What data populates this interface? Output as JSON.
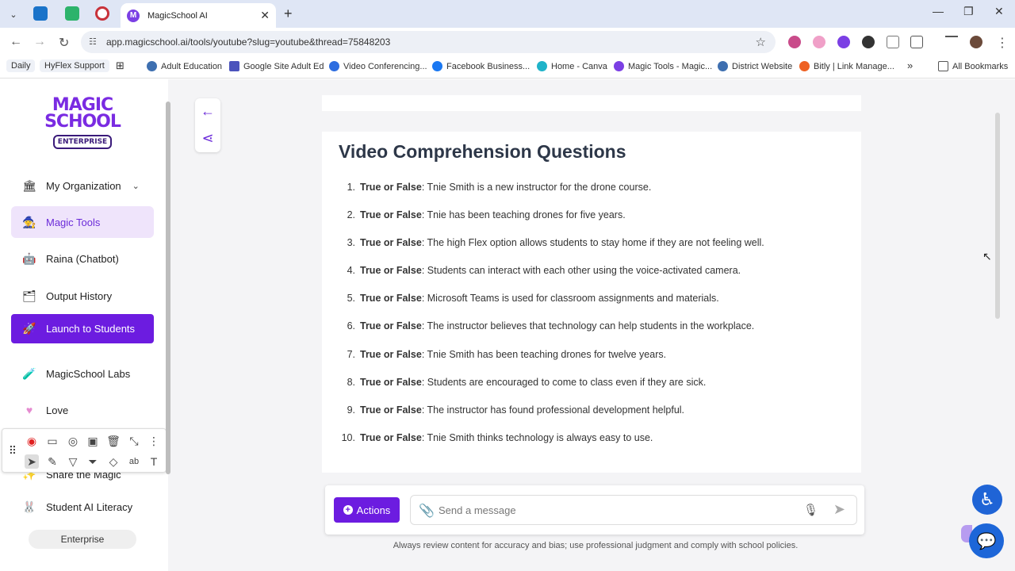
{
  "browser": {
    "tab_title": "MagicSchool AI",
    "tab_favicon": "M",
    "url": "app.magicschool.ai/tools/youtube?slug=youtube&thread=75848203",
    "bookmarks": [
      "Daily",
      "HyFlex Support",
      "Adult Education",
      "Google Site Adult Ed",
      "Video Conferencing...",
      "Facebook Business...",
      "Home - Canva",
      "Magic Tools - Magic...",
      "District Website",
      "Bitly | Link Manage...",
      "All Bookmarks"
    ]
  },
  "sidebar": {
    "logo_line1": "MAGIC",
    "logo_line2": "SCHOOL",
    "logo_badge": "ENTERPRISE",
    "items": [
      {
        "label": "My Organization"
      },
      {
        "label": "Magic Tools"
      },
      {
        "label": "Raina (Chatbot)"
      },
      {
        "label": "Output History"
      },
      {
        "label": "Launch to Students"
      },
      {
        "label": "MagicSchool Labs"
      },
      {
        "label": "Love"
      },
      {
        "label": "Share the Magic"
      },
      {
        "label": "Student AI Literacy"
      }
    ],
    "enterprise_button": "Enterprise"
  },
  "content": {
    "heading": "Video Comprehension Questions",
    "question_prefix": "True or False",
    "questions": [
      {
        "num": "1.",
        "text": ": Tnie Smith is a new instructor for the drone course."
      },
      {
        "num": "2.",
        "text": ": Tnie has been teaching drones for five years."
      },
      {
        "num": "3.",
        "text": ": The high Flex option allows students to stay home if they are not feeling well."
      },
      {
        "num": "4.",
        "text": ": Students can interact with each other using the voice-activated camera."
      },
      {
        "num": "5.",
        "text": ": Microsoft Teams is used for classroom assignments and materials."
      },
      {
        "num": "6.",
        "text": ": The instructor believes that technology can help students in the workplace."
      },
      {
        "num": "7.",
        "text": ": Tnie Smith has been teaching drones for twelve years."
      },
      {
        "num": "8.",
        "text": ": Students are encouraged to come to class even if they are sick."
      },
      {
        "num": "9.",
        "text": ": The instructor has found professional development helpful."
      },
      {
        "num": "10.",
        "text": ": Tnie Smith thinks technology is always easy to use."
      }
    ]
  },
  "composer": {
    "actions_label": "Actions",
    "placeholder": "Send a message",
    "disclaimer": "Always review content for accuracy and bias; use professional judgment and comply with school policies."
  },
  "colors": {
    "brand_purple": "#6c1ce0",
    "active_bg": "#efe4fb",
    "accessibility_blue": "#1f64d6"
  }
}
